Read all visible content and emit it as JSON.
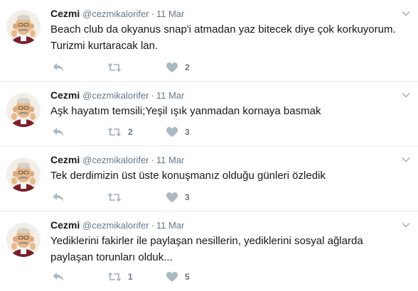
{
  "tweets": [
    {
      "name": "Cezmi",
      "handle": "@cezmikalorifer",
      "separator": "·",
      "time": "11 Mar",
      "text": "Beach club da okyanus snap'i atmadan yaz bitecek diye çok korkuyorum. Turizmi  kurtaracak lan.",
      "retweets": "",
      "likes": "2"
    },
    {
      "name": "Cezmi",
      "handle": "@cezmikalorifer",
      "separator": "·",
      "time": "11 Mar",
      "text": "Aşk hayatım temsili;Yeşil ışık yanmadan kornaya basmak",
      "retweets": "2",
      "likes": "3"
    },
    {
      "name": "Cezmi",
      "handle": "@cezmikalorifer",
      "separator": "·",
      "time": "11 Mar",
      "text": "Tek derdimizin üst üste konuşmanız olduğu günleri özledik",
      "retweets": "",
      "likes": "3"
    },
    {
      "name": "Cezmi",
      "handle": "@cezmikalorifer",
      "separator": "·",
      "time": "11 Mar",
      "text": "Yediklerini fakirler ile paylaşan nesillerin, yediklerini sosyal ağlarda paylaşan torunları olduk...",
      "retweets": "1",
      "likes": "5"
    }
  ],
  "icons": {
    "reply": "reply-icon",
    "retweet": "retweet-icon",
    "like": "heart-icon",
    "more": "chevron-down-icon"
  },
  "colors": {
    "icon_gray": "#aab8c2",
    "text_gray": "#657786",
    "text_dark": "#14171a",
    "divider": "#e6ecf0"
  }
}
